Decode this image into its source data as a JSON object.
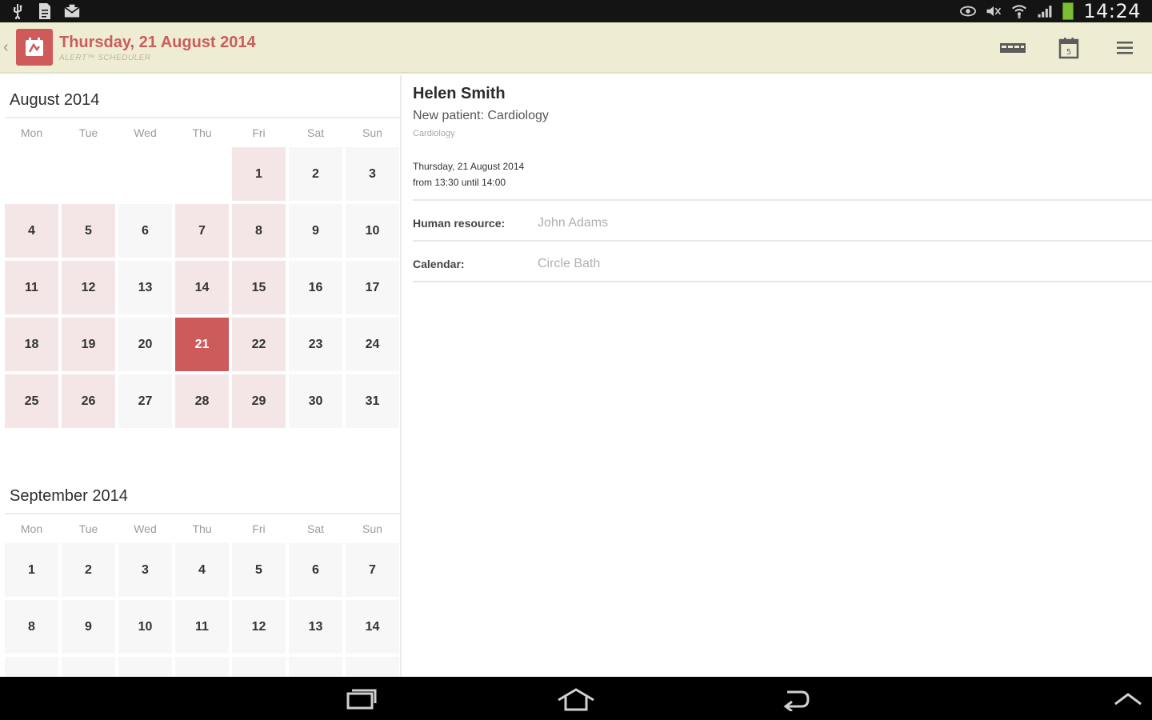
{
  "status_bar": {
    "left_icons": [
      "usb-icon",
      "document-icon",
      "mail-icon"
    ],
    "right_icons": [
      "eye-icon",
      "mute-icon",
      "wifi-icon",
      "signal-icon",
      "battery-icon"
    ],
    "time": "14:24"
  },
  "action_bar": {
    "title": "Thursday, 21 August 2014",
    "subtitle": "ALERT™ SCHEDULER",
    "actions": [
      "calendar-list-icon",
      "today-icon",
      "menu-icon"
    ]
  },
  "calendar": {
    "weekday_headers": [
      "Mon",
      "Tue",
      "Wed",
      "Thu",
      "Fri",
      "Sat",
      "Sun"
    ],
    "months": [
      {
        "title": "August 2014",
        "weekday_headers": [
          "Mon",
          "Tue",
          "Wed",
          "Thu",
          "Fri",
          "Sat",
          "Sun"
        ],
        "days": [
          {
            "label": "",
            "state": "empty"
          },
          {
            "label": "",
            "state": "empty"
          },
          {
            "label": "",
            "state": "empty"
          },
          {
            "label": "",
            "state": "empty"
          },
          {
            "label": "1",
            "state": "pink"
          },
          {
            "label": "2",
            "state": "plain"
          },
          {
            "label": "3",
            "state": "plain"
          },
          {
            "label": "4",
            "state": "pink"
          },
          {
            "label": "5",
            "state": "pink"
          },
          {
            "label": "6",
            "state": "plain"
          },
          {
            "label": "7",
            "state": "pink"
          },
          {
            "label": "8",
            "state": "pink"
          },
          {
            "label": "9",
            "state": "plain"
          },
          {
            "label": "10",
            "state": "plain"
          },
          {
            "label": "11",
            "state": "pink"
          },
          {
            "label": "12",
            "state": "pink"
          },
          {
            "label": "13",
            "state": "plain"
          },
          {
            "label": "14",
            "state": "pink"
          },
          {
            "label": "15",
            "state": "pink"
          },
          {
            "label": "16",
            "state": "plain"
          },
          {
            "label": "17",
            "state": "plain"
          },
          {
            "label": "18",
            "state": "pink"
          },
          {
            "label": "19",
            "state": "pink"
          },
          {
            "label": "20",
            "state": "plain"
          },
          {
            "label": "21",
            "state": "selected"
          },
          {
            "label": "22",
            "state": "pink"
          },
          {
            "label": "23",
            "state": "plain"
          },
          {
            "label": "24",
            "state": "plain"
          },
          {
            "label": "25",
            "state": "pink"
          },
          {
            "label": "26",
            "state": "pink"
          },
          {
            "label": "27",
            "state": "plain"
          },
          {
            "label": "28",
            "state": "pink"
          },
          {
            "label": "29",
            "state": "pink"
          },
          {
            "label": "30",
            "state": "plain"
          },
          {
            "label": "31",
            "state": "plain"
          }
        ]
      },
      {
        "title": "September 2014",
        "weekday_headers": [
          "Mon",
          "Tue",
          "Wed",
          "Thu",
          "Fri",
          "Sat",
          "Sun"
        ],
        "days": [
          {
            "label": "1",
            "state": "plain"
          },
          {
            "label": "2",
            "state": "plain"
          },
          {
            "label": "3",
            "state": "plain"
          },
          {
            "label": "4",
            "state": "plain"
          },
          {
            "label": "5",
            "state": "plain"
          },
          {
            "label": "6",
            "state": "plain"
          },
          {
            "label": "7",
            "state": "plain"
          },
          {
            "label": "8",
            "state": "plain"
          },
          {
            "label": "9",
            "state": "plain"
          },
          {
            "label": "10",
            "state": "plain"
          },
          {
            "label": "11",
            "state": "plain"
          },
          {
            "label": "12",
            "state": "plain"
          },
          {
            "label": "13",
            "state": "plain"
          },
          {
            "label": "14",
            "state": "plain"
          },
          {
            "label": "",
            "state": "plain"
          },
          {
            "label": "",
            "state": "plain"
          },
          {
            "label": "",
            "state": "plain"
          },
          {
            "label": "",
            "state": "plain"
          },
          {
            "label": "",
            "state": "plain"
          },
          {
            "label": "",
            "state": "plain"
          },
          {
            "label": "",
            "state": "plain"
          }
        ]
      }
    ]
  },
  "appointment": {
    "patient_name": "Helen Smith",
    "appointment_type": "New patient: Cardiology",
    "category": "Cardiology",
    "date": "Thursday, 21 August 2014",
    "time_range": "from 13:30 until 14:00",
    "fields": [
      {
        "label": "Human resource:",
        "value": "John Adams"
      },
      {
        "label": "Calendar:",
        "value": "Circle Bath"
      }
    ]
  },
  "nav_bar": {
    "buttons": [
      "recent-apps-icon",
      "home-icon",
      "back-icon",
      "collapse-icon"
    ]
  },
  "colors": {
    "accent": "#cd5b5b",
    "action_bar_bg": "#eeedd3",
    "busy_day_bg": "#f4e6e6",
    "free_day_bg": "#f7f7f7"
  }
}
